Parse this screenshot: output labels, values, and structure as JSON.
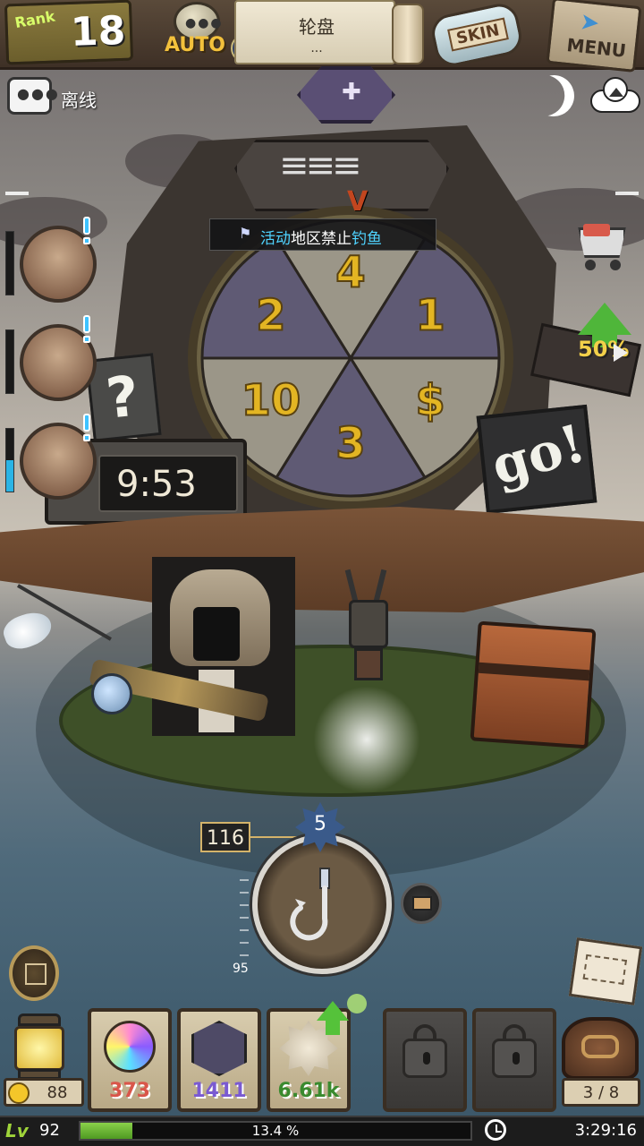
{
  "rank": {
    "label": "Rank",
    "value": "18"
  },
  "auto_button": {
    "label": "AUTO",
    "dots": "●●●"
  },
  "top_scroll": {
    "title": "轮盘",
    "subtitle": "..."
  },
  "skin_button": {
    "label": "SKIN"
  },
  "menu_button": {
    "label": "MENU"
  },
  "chat": {
    "dots": "●●●",
    "status": "离线"
  },
  "wheel": {
    "notice_part1": "活动",
    "notice_part2": "地区",
    "notice_part3": "禁止",
    "notice_part4": "钓鱼",
    "segments": [
      "4",
      "1",
      "$",
      "3",
      "10",
      "2"
    ],
    "pointer": "V",
    "top_symbol": "✚"
  },
  "go_button": {
    "label": "go!"
  },
  "question_panel": {
    "label": "?"
  },
  "timer": {
    "value": "9:53"
  },
  "boost": {
    "label": "50%"
  },
  "portraits": [
    {
      "name": "portrait-1",
      "bar_fill": 0
    },
    {
      "name": "portrait-2",
      "bar_fill": 0
    },
    {
      "name": "portrait-3",
      "bar_fill": 0.5
    }
  ],
  "hook": {
    "level": "5",
    "depth": "116",
    "gauge_min": "95"
  },
  "currency": {
    "coins": "88"
  },
  "inventory": {
    "slots": [
      {
        "type": "orb",
        "count": "373",
        "color": "#d9564a"
      },
      {
        "type": "web",
        "count": "1411",
        "color": "#7a5ad2"
      },
      {
        "type": "shell",
        "count": "6.61k",
        "color": "#3a8a2e",
        "upgrade": true
      },
      {
        "type": "locked"
      },
      {
        "type": "locked"
      }
    ]
  },
  "bag": {
    "count": "3 / 8"
  },
  "status": {
    "level_icon": "Lv",
    "level": "92",
    "xp_percent": 13.4,
    "xp_text": "13.4 %",
    "time": "3:29:16"
  }
}
